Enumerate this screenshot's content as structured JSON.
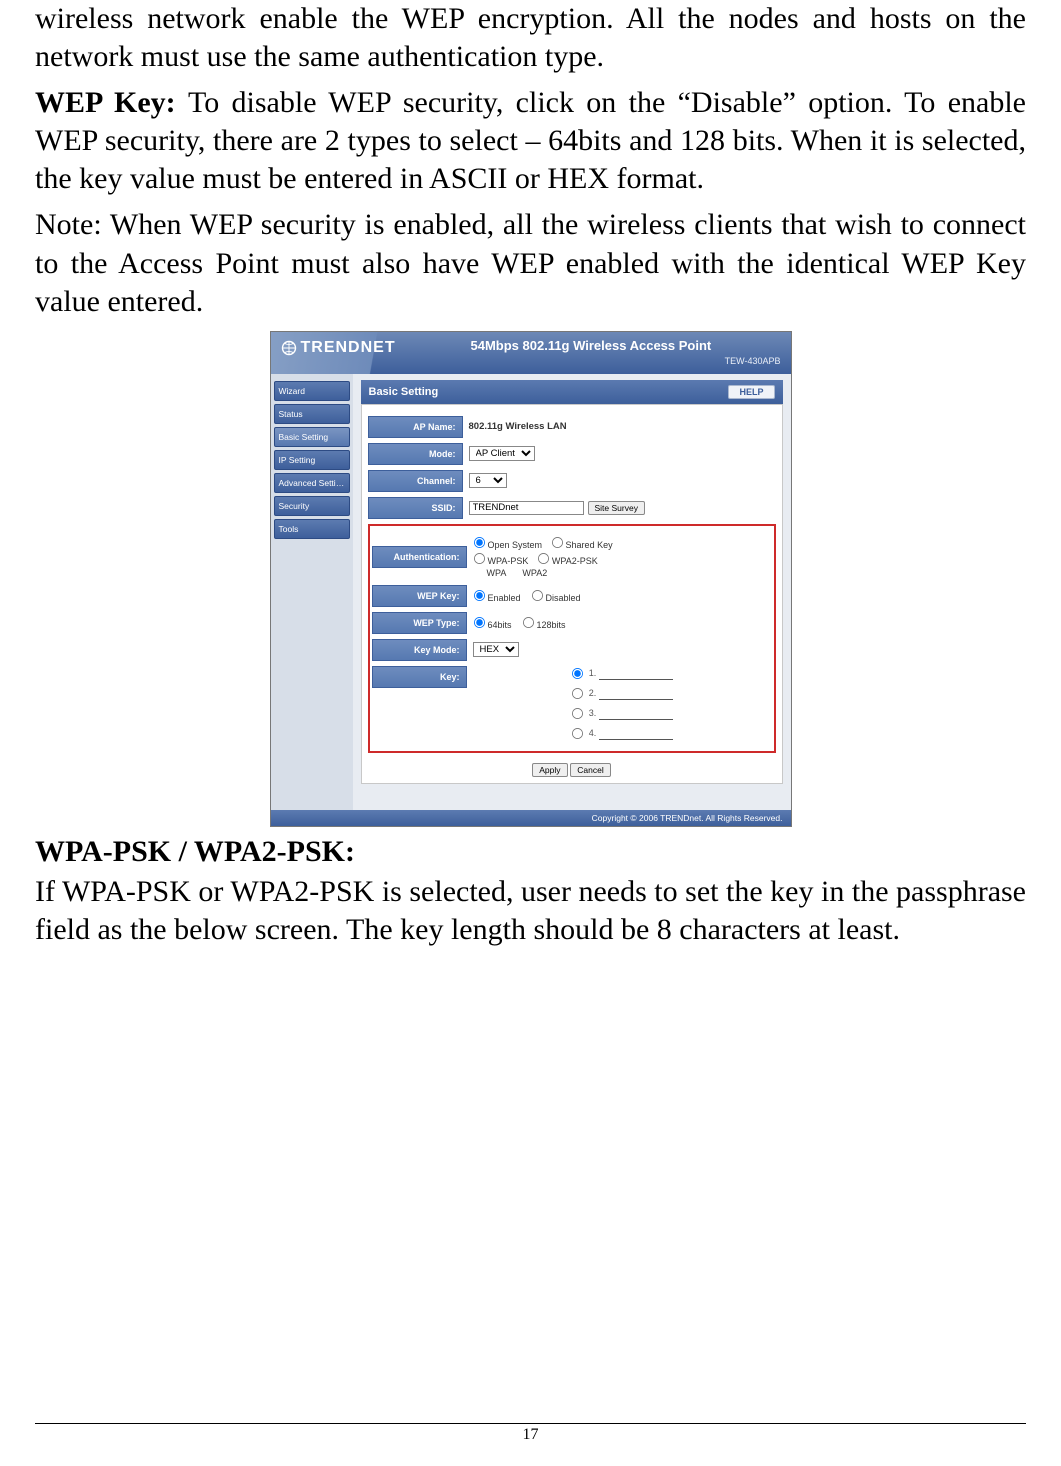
{
  "page": {
    "number": "17"
  },
  "paragraphs": {
    "p1": "wireless network enable the WEP encryption. All the nodes and hosts on the network must use the same authentication type.",
    "p2_prefix": "WEP Key: ",
    "p2_body": "To disable WEP security, click on the “Disable” option. To enable WEP security, there are 2 types to select – 64bits and 128 bits. When it is selected, the key value must be entered in ASCII or HEX format.",
    "p3": "Note: When WEP security is enabled, all the wireless clients that wish to connect to the Access Point must also have WEP enabled with the identical WEP Key value entered.",
    "h2": "WPA-PSK / WPA2-PSK:",
    "p4": "If WPA-PSK or WPA2-PSK is selected, user needs to set the key in the passphrase field as the below screen. The key length should be 8 characters at least."
  },
  "ui": {
    "brand": "TRENDNET",
    "header_title": "54Mbps 802.11g Wireless Access Point",
    "header_subtitle": "TEW-430APB",
    "sidebar": [
      {
        "label": "Wizard"
      },
      {
        "label": "Status"
      },
      {
        "label": "Basic Setting"
      },
      {
        "label": "IP Setting"
      },
      {
        "label": "Advanced Setting"
      },
      {
        "label": "Security"
      },
      {
        "label": "Tools"
      }
    ],
    "panel_title": "Basic Setting",
    "help": "HELP",
    "labels": {
      "ap_name": "AP Name:",
      "mode": "Mode:",
      "channel": "Channel:",
      "ssid": "SSID:",
      "authentication": "Authentication:",
      "wep_key": "WEP Key:",
      "wep_type": "WEP Type:",
      "key_mode": "Key Mode:",
      "key": "Key:"
    },
    "values": {
      "ap_name": "802.11g Wireless LAN",
      "mode_option": "AP Client",
      "channel_option": "6",
      "ssid": "TRENDnet",
      "site_survey": "Site Survey",
      "auth_opts": {
        "open_system": "Open System",
        "shared_key": "Shared Key",
        "wpa_psk": "WPA-PSK",
        "wpa2_psk": "WPA2-PSK",
        "wpa": "WPA",
        "wpa2": "WPA2"
      },
      "wep_enabled": "Enabled",
      "wep_disabled": "Disabled",
      "wep_64": "64bits",
      "wep_128": "128bits",
      "key_mode_option": "HEX",
      "key_nums": {
        "k1": "1.",
        "k2": "2.",
        "k3": "3.",
        "k4": "4."
      }
    },
    "buttons": {
      "apply": "Apply",
      "cancel": "Cancel"
    },
    "copyright": "Copyright © 2006 TRENDnet. All Rights Reserved."
  }
}
